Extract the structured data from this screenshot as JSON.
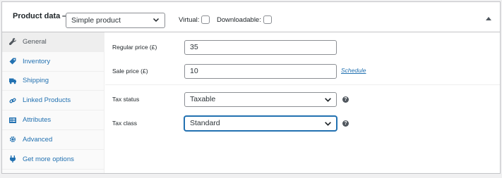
{
  "header": {
    "title": "Product data —",
    "product_type": "Simple product",
    "virtual_label": "Virtual:",
    "downloadable_label": "Downloadable:"
  },
  "sidebar": {
    "items": [
      {
        "label": "General",
        "icon": "wrench-icon"
      },
      {
        "label": "Inventory",
        "icon": "tag-icon"
      },
      {
        "label": "Shipping",
        "icon": "truck-icon"
      },
      {
        "label": "Linked Products",
        "icon": "link-icon"
      },
      {
        "label": "Attributes",
        "icon": "list-icon"
      },
      {
        "label": "Advanced",
        "icon": "gear-icon"
      },
      {
        "label": "Get more options",
        "icon": "plugin-icon"
      }
    ]
  },
  "general": {
    "regular_price_label": "Regular price (£)",
    "regular_price_value": "35",
    "sale_price_label": "Sale price (£)",
    "sale_price_value": "10",
    "schedule_link": "Schedule",
    "tax_status_label": "Tax status",
    "tax_status_value": "Taxable",
    "tax_class_label": "Tax class",
    "tax_class_value": "Standard",
    "help_glyph": "?"
  },
  "colors": {
    "link": "#2271b1",
    "active_tab_bg": "#eeeeee",
    "focus_border": "#2271b1"
  }
}
